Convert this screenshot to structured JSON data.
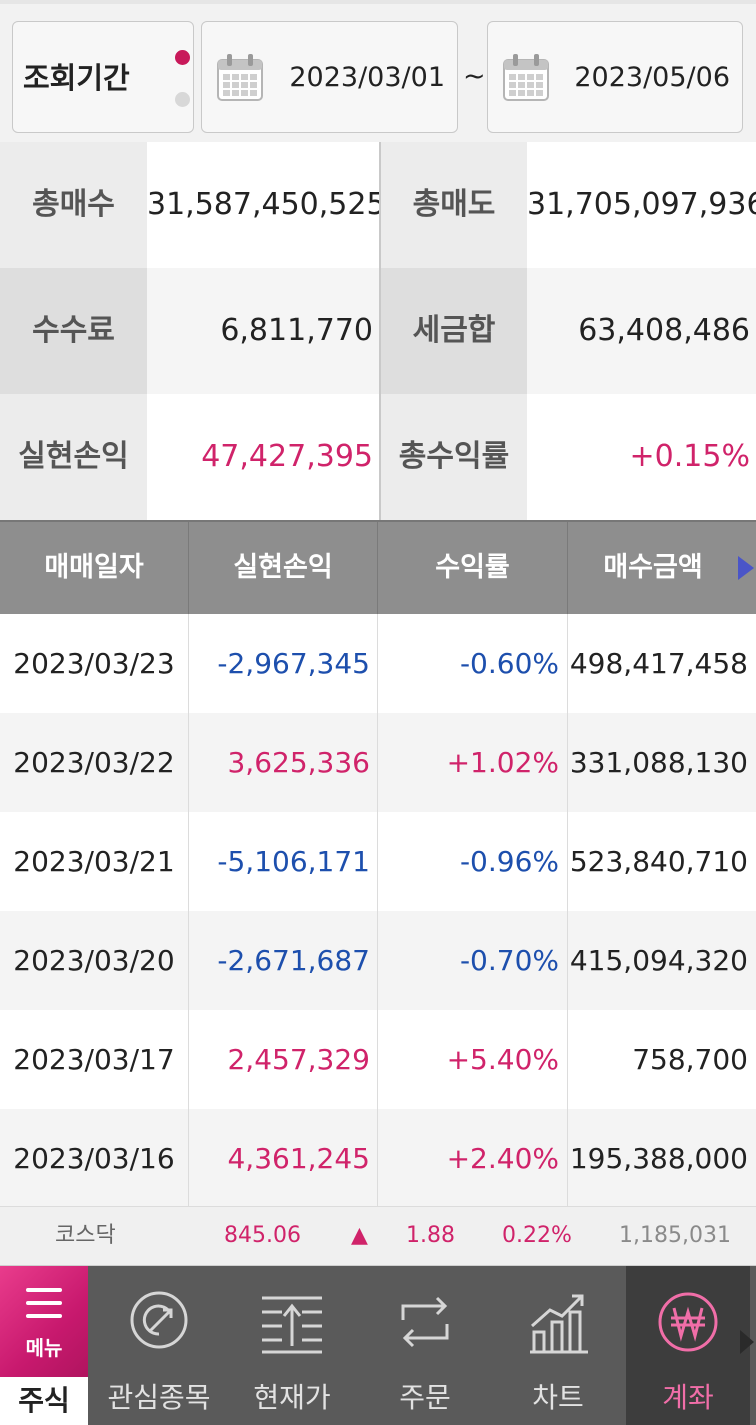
{
  "period": {
    "label": "조회기간",
    "start": "2023/03/01",
    "separator": "~",
    "end": "2023/05/06",
    "calendar_icon": "calendar-icon"
  },
  "summary": {
    "total_buy_label": "총매수",
    "total_buy": "31,587,450,525",
    "total_sell_label": "총매도",
    "total_sell": "31,705,097,936",
    "fee_label": "수수료",
    "fee": "6,811,770",
    "tax_label": "세금합",
    "tax": "63,408,486",
    "realized_label": "실현손익",
    "realized": "47,427,395",
    "return_label": "총수익률",
    "return": "+0.15%"
  },
  "table": {
    "headers": [
      "매매일자",
      "실현손익",
      "수익률",
      "매수금액"
    ],
    "rows": [
      {
        "date": "2023/03/23",
        "pnl": "-2,967,345",
        "rate": "-0.60%",
        "buy": "498,417,458",
        "sign": "neg"
      },
      {
        "date": "2023/03/22",
        "pnl": "3,625,336",
        "rate": "+1.02%",
        "buy": "331,088,130",
        "sign": "pos"
      },
      {
        "date": "2023/03/21",
        "pnl": "-5,106,171",
        "rate": "-0.96%",
        "buy": "523,840,710",
        "sign": "neg"
      },
      {
        "date": "2023/03/20",
        "pnl": "-2,671,687",
        "rate": "-0.70%",
        "buy": "415,094,320",
        "sign": "neg"
      },
      {
        "date": "2023/03/17",
        "pnl": "2,457,329",
        "rate": "+5.40%",
        "buy": "758,700",
        "sign": "pos"
      },
      {
        "date": "2023/03/16",
        "pnl": "4,361,245",
        "rate": "+2.40%",
        "buy": "195,388,000",
        "sign": "pos"
      }
    ]
  },
  "ticker": {
    "name": "코스닥",
    "index": "845.06",
    "direction_icon": "up-triangle-icon",
    "change": "1.88",
    "rate": "0.22%",
    "volume": "1,185,031"
  },
  "nav": {
    "menu_label": "메뉴",
    "stock_label": "주식",
    "items": [
      {
        "label": "관심종목",
        "icon": "watchlist-icon"
      },
      {
        "label": "현재가",
        "icon": "current-price-icon"
      },
      {
        "label": "주문",
        "icon": "order-icon"
      },
      {
        "label": "차트",
        "icon": "chart-icon"
      },
      {
        "label": "계좌",
        "icon": "account-won-icon",
        "active": true
      }
    ]
  },
  "colors": {
    "accent": "#d0236a",
    "negative": "#1d4fad",
    "header_bg": "#8e8e8e",
    "nav_bg": "#5a5a5a"
  }
}
